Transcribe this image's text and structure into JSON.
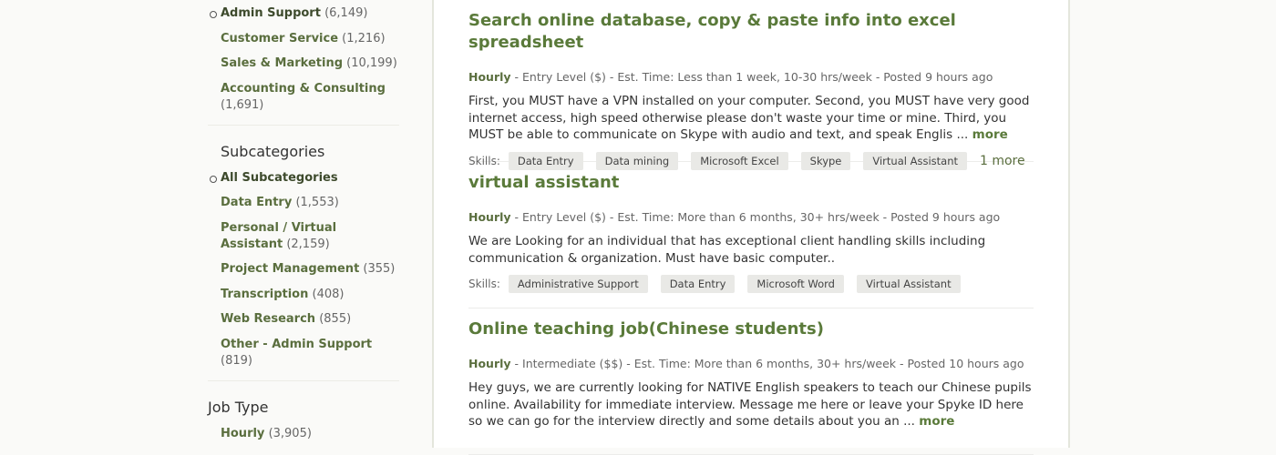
{
  "sidebar": {
    "categories": [
      {
        "label": "Admin Support",
        "count": "(6,149)",
        "selected": true
      },
      {
        "label": "Customer Service",
        "count": "(1,216)"
      },
      {
        "label": "Sales & Marketing",
        "count": "(10,199)"
      },
      {
        "label": "Accounting & Consulting",
        "count": "(1,691)"
      }
    ],
    "subcategories_heading": "Subcategories",
    "subcategories": [
      {
        "label": "All Subcategories",
        "count": "",
        "selected": true
      },
      {
        "label": "Data Entry",
        "count": "(1,553)"
      },
      {
        "label": "Personal / Virtual Assistant",
        "count": "(2,159)"
      },
      {
        "label": "Project Management",
        "count": "(355)"
      },
      {
        "label": "Transcription",
        "count": "(408)"
      },
      {
        "label": "Web Research",
        "count": "(855)"
      },
      {
        "label": "Other - Admin Support",
        "count": "(819)"
      }
    ],
    "job_type_heading": "Job Type",
    "job_types": [
      {
        "label": "Hourly",
        "count": "(3,905)"
      }
    ]
  },
  "jobs": [
    {
      "title": "Search online database, copy & paste info into excel spreadsheet",
      "type": "Hourly",
      "meta": " - Entry Level ($) - Est. Time: Less than 1 week, 10-30 hrs/week - Posted 9 hours ago",
      "desc": "First, you MUST have a VPN installed on your computer. Second, you MUST have very good internet access, high speed otherwise please don't waste your time or mine. Third, you MUST be able to communicate on Skype with audio and text, and speak Englis ... ",
      "more": "more",
      "skills_label": "Skills:",
      "skills": [
        "Data Entry",
        "Data mining",
        "Microsoft Excel",
        "Skype",
        "Virtual Assistant"
      ],
      "more_skills": "1 more"
    },
    {
      "title": "virtual assistant",
      "type": "Hourly",
      "meta": " - Entry Level ($) - Est. Time: More than 6 months, 30+ hrs/week - Posted 9 hours ago",
      "desc": "We are Looking for an individual that has exceptional client handling skills including communication & organization. Must have basic computer..",
      "more": "",
      "skills_label": "Skills:",
      "skills": [
        "Administrative Support",
        "Data Entry",
        "Microsoft Word",
        "Virtual Assistant"
      ],
      "more_skills": ""
    },
    {
      "title": "Online teaching job(Chinese students)",
      "type": "Hourly",
      "meta": " - Intermediate ($$) - Est. Time: More than 6 months, 30+ hrs/week - Posted 10 hours ago",
      "desc": "Hey guys, we are currently looking for NATIVE English speakers to teach our Chinese pupils online. Availability for immediate interview. Message me here or leave your Spyke ID here so we can go for the interview directly and some details about you an ... ",
      "more": "more"
    }
  ]
}
